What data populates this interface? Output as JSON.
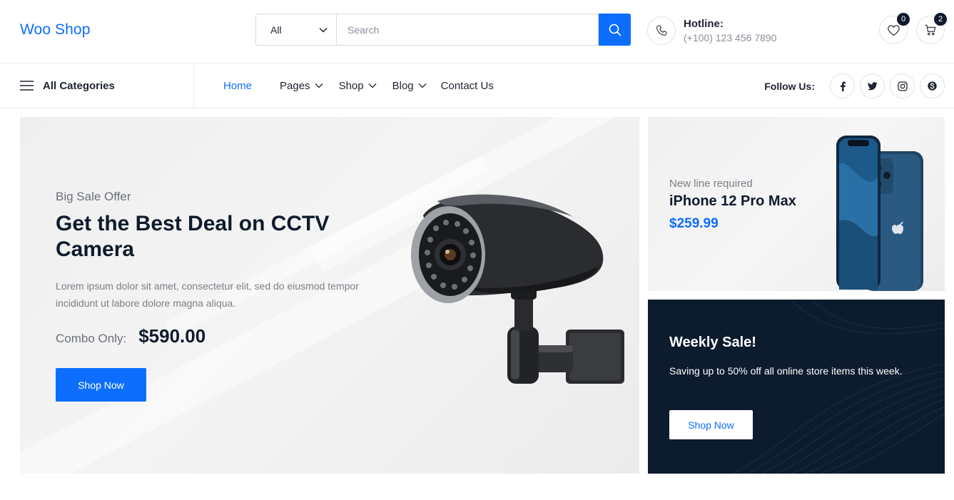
{
  "header": {
    "logo": "Woo Shop",
    "search": {
      "category": "All",
      "placeholder": "Search"
    },
    "hotline": {
      "label": "Hotline:",
      "number": "(+100) 123 456 7890"
    },
    "wishlist_count": "0",
    "cart_count": "2"
  },
  "nav": {
    "all_categories": "All Categories",
    "menu": [
      {
        "label": "Home",
        "has_dropdown": false,
        "active": true
      },
      {
        "label": "Pages",
        "has_dropdown": true,
        "active": false
      },
      {
        "label": "Shop",
        "has_dropdown": true,
        "active": false
      },
      {
        "label": "Blog",
        "has_dropdown": true,
        "active": false
      },
      {
        "label": "Contact Us",
        "has_dropdown": false,
        "active": false
      }
    ],
    "follow_label": "Follow Us:",
    "social": [
      "facebook-icon",
      "twitter-icon",
      "instagram-icon",
      "skype-icon"
    ]
  },
  "hero": {
    "subtitle": "Big Sale Offer",
    "title": "Get the Best Deal on CCTV Camera",
    "description": "Lorem ipsum dolor sit amet, consectetur elit, sed do eiusmod tempor incididunt ut labore dolore magna aliqua.",
    "combo_label": "Combo Only:",
    "price": "$590.00",
    "button": "Shop Now"
  },
  "promo_iphone": {
    "subtitle": "New line required",
    "title": "iPhone 12 Pro Max",
    "price": "$259.99"
  },
  "promo_weekly": {
    "title": "Weekly Sale!",
    "description": "Saving up to 50% off all online store items this week.",
    "button": "Shop Now"
  },
  "colors": {
    "accent": "#0d6efd",
    "dark": "#0c1b2e",
    "text": "#1e2330",
    "muted": "#7a7f88"
  }
}
